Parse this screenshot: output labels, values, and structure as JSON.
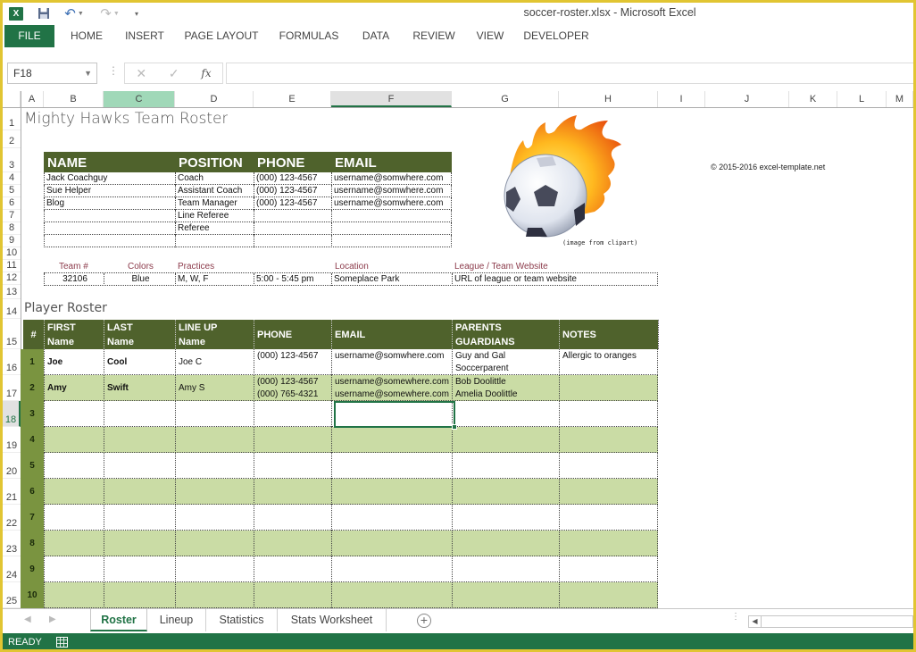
{
  "window": {
    "title": "soccer-roster.xlsx - Microsoft Excel",
    "app_icon": "excel-icon",
    "qat": [
      "save-icon",
      "undo-icon",
      "redo-icon",
      "customize-icon"
    ]
  },
  "ribbon": {
    "tabs": [
      "FILE",
      "HOME",
      "INSERT",
      "PAGE LAYOUT",
      "FORMULAS",
      "DATA",
      "REVIEW",
      "VIEW",
      "DEVELOPER"
    ]
  },
  "formula_bar": {
    "name_box": "F18",
    "cancel_glyph": "✕",
    "enter_glyph": "✓",
    "fx_label": "fx",
    "value": ""
  },
  "columns": [
    "A",
    "B",
    "C",
    "D",
    "E",
    "F",
    "G",
    "H",
    "I",
    "J",
    "K",
    "L",
    "M"
  ],
  "rows": [
    "1",
    "2",
    "3",
    "4",
    "5",
    "6",
    "7",
    "8",
    "9",
    "10",
    "11",
    "12",
    "13",
    "14",
    "15",
    "16",
    "17",
    "18",
    "19",
    "20",
    "21",
    "22",
    "23",
    "24",
    "25"
  ],
  "selection": {
    "cell": "F18",
    "selected_column": "F",
    "selected_row": "18"
  },
  "sheet": {
    "title": "Mighty Hawks Team Roster",
    "staff": {
      "headers": [
        "NAME",
        "POSITION",
        "PHONE",
        "EMAIL"
      ],
      "rows": [
        [
          "Jack Coachguy",
          "Coach",
          "(000) 123-4567",
          "username@somwhere.com"
        ],
        [
          "Sue Helper",
          "Assistant Coach",
          "(000) 123-4567",
          "username@somwhere.com"
        ],
        [
          "Blog",
          "Team Manager",
          "(000) 123-4567",
          "username@somwhere.com"
        ],
        [
          "",
          "Line Referee",
          "",
          ""
        ],
        [
          "",
          "Referee",
          "",
          ""
        ],
        [
          "",
          "",
          "",
          ""
        ]
      ]
    },
    "clipart_caption": "(image from clipart)",
    "copyright": "© 2015-2016 excel-template.net",
    "team_info": {
      "labels": {
        "team_no": "Team #",
        "colors": "Colors",
        "practices": "Practices",
        "location": "Location",
        "website": "League / Team Website"
      },
      "values": {
        "team_no": "32106",
        "colors": "Blue",
        "practice_days": "M, W, F",
        "practice_time": "5:00 - 5:45 pm",
        "location": "Someplace Park",
        "website": "URL of league or team website"
      }
    },
    "player_roster": {
      "title": "Player Roster",
      "headers": [
        [
          "#"
        ],
        [
          "FIRST",
          "Name"
        ],
        [
          "LAST",
          "Name"
        ],
        [
          "LINE UP",
          "Name"
        ],
        [
          "PHONE"
        ],
        [
          "EMAIL"
        ],
        [
          "PARENTS",
          "GUARDIANS"
        ],
        [
          "NOTES"
        ]
      ],
      "players": [
        {
          "num": "1",
          "first": "Joe",
          "last": "Cool",
          "lineup": "Joe C",
          "phone": [
            "(000) 123-4567"
          ],
          "email": [
            "username@somwhere.com"
          ],
          "parents": [
            "Guy and Gal",
            "Soccerparent"
          ],
          "notes": "Allergic to oranges"
        },
        {
          "num": "2",
          "first": "Amy",
          "last": "Swift",
          "lineup": "Amy S",
          "phone": [
            "(000) 123-4567",
            "(000) 765-4321"
          ],
          "email": [
            "username@somewhere.com",
            "username@somewhere.com"
          ],
          "parents": [
            "Bob Doolittle",
            "Amelia Doolittle"
          ],
          "notes": ""
        },
        {
          "num": "3",
          "first": "",
          "last": "",
          "lineup": "",
          "phone": [
            ""
          ],
          "email": [
            ""
          ],
          "parents": [
            ""
          ],
          "notes": ""
        },
        {
          "num": "4",
          "first": "",
          "last": "",
          "lineup": "",
          "phone": [
            ""
          ],
          "email": [
            ""
          ],
          "parents": [
            ""
          ],
          "notes": ""
        },
        {
          "num": "5",
          "first": "",
          "last": "",
          "lineup": "",
          "phone": [
            ""
          ],
          "email": [
            ""
          ],
          "parents": [
            ""
          ],
          "notes": ""
        },
        {
          "num": "6",
          "first": "",
          "last": "",
          "lineup": "",
          "phone": [
            ""
          ],
          "email": [
            ""
          ],
          "parents": [
            ""
          ],
          "notes": ""
        },
        {
          "num": "7",
          "first": "",
          "last": "",
          "lineup": "",
          "phone": [
            ""
          ],
          "email": [
            ""
          ],
          "parents": [
            ""
          ],
          "notes": ""
        },
        {
          "num": "8",
          "first": "",
          "last": "",
          "lineup": "",
          "phone": [
            ""
          ],
          "email": [
            ""
          ],
          "parents": [
            ""
          ],
          "notes": ""
        },
        {
          "num": "9",
          "first": "",
          "last": "",
          "lineup": "",
          "phone": [
            ""
          ],
          "email": [
            ""
          ],
          "parents": [
            ""
          ],
          "notes": ""
        },
        {
          "num": "10",
          "first": "",
          "last": "",
          "lineup": "",
          "phone": [
            ""
          ],
          "email": [
            ""
          ],
          "parents": [
            ""
          ],
          "notes": ""
        }
      ]
    }
  },
  "sheet_tabs": {
    "tabs": [
      "Roster",
      "Lineup",
      "Statistics",
      "Stats Worksheet"
    ],
    "active": "Roster",
    "add_glyph": "+"
  },
  "status_bar": {
    "status": "READY"
  },
  "colors": {
    "excel_green": "#217346",
    "header_olive": "#4f622c",
    "row_band": "#cadca5",
    "num_col": "#7a9440",
    "label_maroon": "#8b3a4a",
    "window_border": "#e1c532"
  }
}
